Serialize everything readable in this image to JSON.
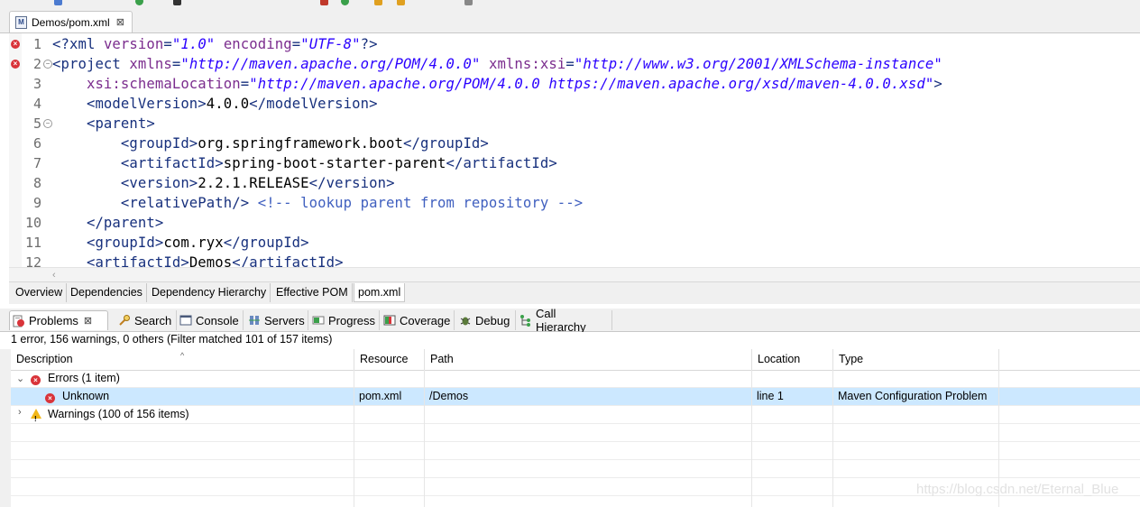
{
  "editor": {
    "tab_title": "Demos/pom.xml",
    "lines": [
      {
        "n": "1",
        "marker": "error",
        "fold": false,
        "indent": "",
        "parts": [
          [
            "tag",
            "<?xml "
          ],
          [
            "attr",
            "version"
          ],
          [
            "tag",
            "="
          ],
          [
            "val",
            "\"1.0\""
          ],
          [
            "tag",
            " "
          ],
          [
            "attr",
            "encoding"
          ],
          [
            "tag",
            "="
          ],
          [
            "val",
            "\"UTF-8\""
          ],
          [
            "tag",
            "?>"
          ]
        ]
      },
      {
        "n": "2",
        "marker": "error",
        "fold": true,
        "indent": "",
        "parts": [
          [
            "tag",
            "<project "
          ],
          [
            "attr",
            "xmlns"
          ],
          [
            "tag",
            "="
          ],
          [
            "val",
            "\"http://maven.apache.org/POM/4.0.0\""
          ],
          [
            "tag",
            " "
          ],
          [
            "attr",
            "xmlns:xsi"
          ],
          [
            "tag",
            "="
          ],
          [
            "val",
            "\"http://www.w3.org/2001/XMLSchema-instance\""
          ]
        ]
      },
      {
        "n": "3",
        "marker": "",
        "fold": false,
        "indent": "    ",
        "parts": [
          [
            "attr",
            "xsi:schemaLocation"
          ],
          [
            "tag",
            "="
          ],
          [
            "val",
            "\"http://maven.apache.org/POM/4.0.0 https://maven.apache.org/xsd/maven-4.0.0.xsd\""
          ],
          [
            "tag",
            ">"
          ]
        ]
      },
      {
        "n": "4",
        "marker": "",
        "fold": false,
        "indent": "    ",
        "parts": [
          [
            "tag",
            "<modelVersion>"
          ],
          [
            "txt",
            "4.0.0"
          ],
          [
            "tag",
            "</modelVersion>"
          ]
        ]
      },
      {
        "n": "5",
        "marker": "",
        "fold": true,
        "indent": "    ",
        "parts": [
          [
            "tag",
            "<parent>"
          ]
        ]
      },
      {
        "n": "6",
        "marker": "",
        "fold": false,
        "indent": "        ",
        "parts": [
          [
            "tag",
            "<groupId>"
          ],
          [
            "txt",
            "org.springframework.boot"
          ],
          [
            "tag",
            "</groupId>"
          ]
        ]
      },
      {
        "n": "7",
        "marker": "",
        "fold": false,
        "indent": "        ",
        "parts": [
          [
            "tag",
            "<artifactId>"
          ],
          [
            "txt",
            "spring-boot-starter-parent"
          ],
          [
            "tag",
            "</artifactId>"
          ]
        ]
      },
      {
        "n": "8",
        "marker": "",
        "fold": false,
        "indent": "        ",
        "parts": [
          [
            "tag",
            "<version>"
          ],
          [
            "txt",
            "2.2.1.RELEASE"
          ],
          [
            "tag",
            "</version>"
          ]
        ]
      },
      {
        "n": "9",
        "marker": "",
        "fold": false,
        "indent": "        ",
        "parts": [
          [
            "tag",
            "<relativePath/> "
          ],
          [
            "cmt",
            "<!-- lookup parent from repository -->"
          ]
        ]
      },
      {
        "n": "10",
        "marker": "",
        "fold": false,
        "indent": "    ",
        "parts": [
          [
            "tag",
            "</parent>"
          ]
        ]
      },
      {
        "n": "11",
        "marker": "",
        "fold": false,
        "indent": "    ",
        "parts": [
          [
            "tag",
            "<groupId>"
          ],
          [
            "txt",
            "com.ryx"
          ],
          [
            "tag",
            "</groupId>"
          ]
        ]
      },
      {
        "n": "12",
        "marker": "",
        "fold": false,
        "indent": "    ",
        "parts": [
          [
            "tag",
            "<artifactId>"
          ],
          [
            "txt",
            "Demos"
          ],
          [
            "tag",
            "</artifactId>"
          ]
        ]
      }
    ]
  },
  "pom_tabs": [
    "Overview",
    "Dependencies",
    "Dependency Hierarchy",
    "Effective POM",
    "pom.xml"
  ],
  "views": [
    {
      "label": "Problems",
      "icon": "problems-icon"
    },
    {
      "label": "Search",
      "icon": "search-icon"
    },
    {
      "label": "Console",
      "icon": "console-icon"
    },
    {
      "label": "Servers",
      "icon": "servers-icon"
    },
    {
      "label": "Progress",
      "icon": "progress-icon"
    },
    {
      "label": "Coverage",
      "icon": "coverage-icon"
    },
    {
      "label": "Debug",
      "icon": "debug-icon"
    },
    {
      "label": "Call Hierarchy",
      "icon": "call-hierarchy-icon"
    }
  ],
  "problems": {
    "summary": "1 error, 156 warnings, 0 others (Filter matched 101 of 157 items)",
    "columns": [
      "Description",
      "Resource",
      "Path",
      "Location",
      "Type"
    ],
    "errors_group": "Errors (1 item)",
    "error_row": {
      "description": "Unknown",
      "resource": "pom.xml",
      "path": "/Demos",
      "location": "line 1",
      "type": "Maven Configuration Problem"
    },
    "warnings_group": "Warnings (100 of 156 items)"
  },
  "watermark": "https://blog.csdn.net/Eternal_Blue",
  "colors": {
    "tag": "#17307d",
    "attr": "#7b2d8e",
    "value": "#2a00ff",
    "comment": "#3f5fbf",
    "selection": "#cce8ff",
    "error": "#d9343a",
    "warning": "#f2b718"
  }
}
